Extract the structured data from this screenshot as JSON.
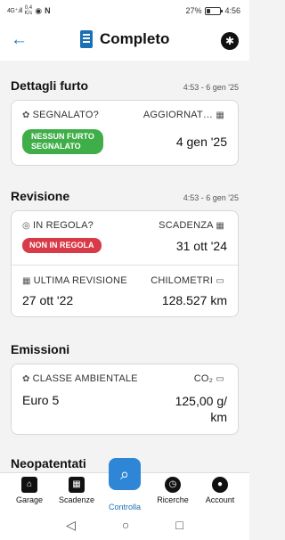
{
  "status_bar": {
    "signal": "4G⁺.ıll",
    "speed": "0,4\nK/s",
    "battery_percent": "27%",
    "battery_level": 0.27,
    "time": "4:56"
  },
  "app_bar": {
    "title": "Completo",
    "icons": [
      "back-arrow-icon",
      "document-icon",
      "settings-icon"
    ]
  },
  "sections": {
    "furto": {
      "title": "Dettagli furto",
      "time": "4:53 - 6 gen '25",
      "segnalato_label": "SEGNALATO?",
      "segnalato_badge": "NESSUN FURTO\nSEGNALATO",
      "aggiornato_label": "AGGIORNAT…",
      "aggiornato_value": "4 gen '25"
    },
    "revisione": {
      "title": "Revisione",
      "time": "4:53 - 6 gen '25",
      "in_regola_label": "IN REGOLA?",
      "in_regola_badge": "NON IN REGOLA",
      "scadenza_label": "SCADENZA",
      "scadenza_value": "31 ott '24",
      "ultima_label": "ULTIMA REVISIONE",
      "ultima_value": "27 ott '22",
      "km_label": "CHILOMETRI",
      "km_value": "128.527 km"
    },
    "emissioni": {
      "title": "Emissioni",
      "classe_label": "CLASSE AMBIENTALE",
      "classe_value": "Euro 5",
      "co2_label": "CO₂",
      "co2_value": "125,00 g/\nkm"
    },
    "neopatentati": {
      "title": "Neopatentati"
    }
  },
  "bottom_nav": {
    "items": [
      {
        "label": "Garage",
        "icon": "garage-icon"
      },
      {
        "label": "Scadenze",
        "icon": "calendar-icon"
      },
      {
        "label": "Controlla",
        "icon": "search-icon",
        "active": true
      },
      {
        "label": "Ricerche",
        "icon": "history-icon"
      },
      {
        "label": "Account",
        "icon": "account-icon"
      }
    ]
  },
  "colors": {
    "accent": "#1a6fb5",
    "green_badge": "#3fae49",
    "red_badge": "#d83a48"
  }
}
